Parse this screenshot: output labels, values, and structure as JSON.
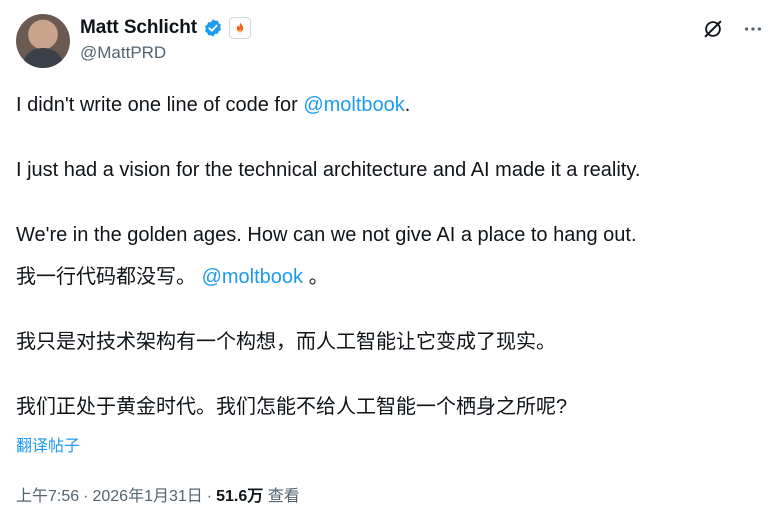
{
  "author": {
    "display_name": "Matt Schlicht",
    "handle": "@MattPRD",
    "verified_badge_color": "#1d9bf0"
  },
  "icons": {
    "verified": "verified-badge-icon",
    "affiliate": "flame-badge-icon",
    "grok": "grok-icon",
    "more": "more-options-icon"
  },
  "tweet": {
    "line1_prefix": "I didn't write one line of code for ",
    "line1_mention": "@moltbook",
    "line1_suffix": ".",
    "line2": "I just had a vision for the technical architecture and AI made it a reality.",
    "line3": "We're in the golden ages. How can we not give AI a place to hang out.",
    "zh_line1_prefix": "我一行代码都没写。 ",
    "zh_line1_mention": "@moltbook",
    "zh_line1_suffix": " 。",
    "zh_line2": "我只是对技术架构有一个构想，而人工智能让它变成了现实。",
    "zh_line3": "我们正处于黄金时代。我们怎能不给人工智能一个栖身之所呢?"
  },
  "translate_label": "翻译帖子",
  "meta": {
    "time": "上午7:56",
    "date": "2026年1月31日",
    "separator": "·",
    "views_count": "51.6万",
    "views_label": "查看"
  }
}
